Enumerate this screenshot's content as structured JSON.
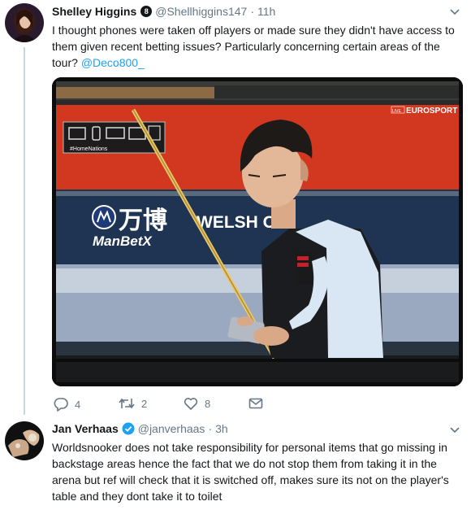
{
  "tweet1": {
    "author_name": "Shelley Higgins",
    "badge": "8",
    "handle": "@Shellhiggins147",
    "separator": "·",
    "time": "11h",
    "text_main": "I thought phones were taken off players or made sure they didn't have access to them given recent betting issues? Particularly concerning certain areas of the tour? ",
    "mention": "@Deco800_",
    "media": {
      "broadcast_logo": "EUROSPORT",
      "live_tag": "LIVE",
      "hashtag": "#HomeNations",
      "sponsor_cn": "万博",
      "sponsor_en": "ManBetX",
      "event_text": "WELSH O"
    },
    "stats": {
      "replies": "4",
      "retweets": "2",
      "likes": "8"
    }
  },
  "tweet2": {
    "author_name": "Jan Verhaas",
    "handle": "@janverhaas",
    "separator": "·",
    "time": "3h",
    "text": "Worldsnooker does not take responsibility for personal items that go missing in backstage areas hence the fact that we do not stop them from taking it in the arena but ref will check that it is switched off, makes sure its not on the player's table and they dont take it to toilet"
  },
  "icons": {
    "reply": "reply-icon",
    "retweet": "retweet-icon",
    "like": "heart-icon",
    "dm": "envelope-icon",
    "caret": "chevron-down-icon",
    "verified": "verified-icon"
  },
  "colors": {
    "accent": "#1da1f2",
    "muted": "#657786",
    "text": "#14171a",
    "thread": "#ccd6dd"
  }
}
